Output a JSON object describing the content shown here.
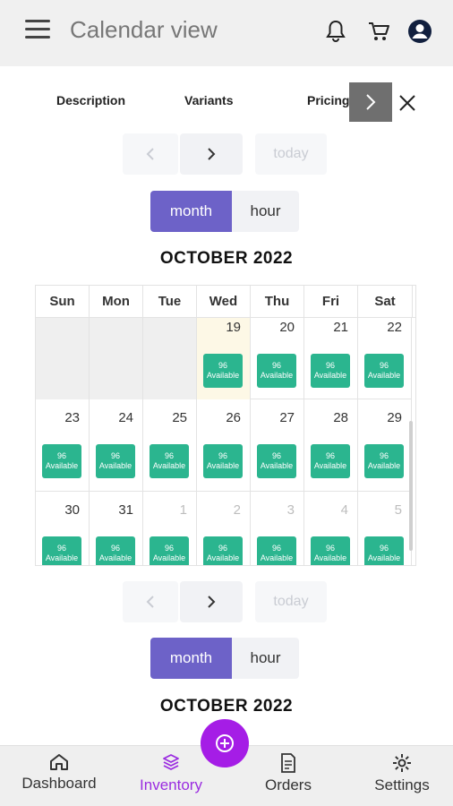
{
  "appbar": {
    "title": "Calendar view"
  },
  "tabs": [
    {
      "label": "Description"
    },
    {
      "label": "Variants"
    },
    {
      "label": "Pricing"
    }
  ],
  "nav": {
    "today_label": "today"
  },
  "view_toggle": {
    "month": "month",
    "hour": "hour"
  },
  "calendar": {
    "title": "OCTOBER 2022",
    "weekdays": [
      "Sun",
      "Mon",
      "Tue",
      "Wed",
      "Thu",
      "Fri",
      "Sat"
    ],
    "weeks": [
      [
        "",
        "",
        "",
        "19",
        "20",
        "21",
        "22"
      ],
      [
        "23",
        "24",
        "25",
        "26",
        "27",
        "28",
        "29"
      ],
      [
        "30",
        "31",
        "1",
        "2",
        "3",
        "4",
        "5"
      ]
    ],
    "chip_count": "96",
    "chip_text": "Available"
  },
  "calendar2": {
    "title": "OCTOBER 2022"
  },
  "bottom_nav": [
    {
      "label": "Dashboard"
    },
    {
      "label": "Inventory"
    },
    {
      "label": "Orders"
    },
    {
      "label": "Settings"
    }
  ],
  "colors": {
    "accent": "#6d62c8",
    "chip": "#2bb58f",
    "fab": "#a51de6",
    "active_nav": "#9a2be0"
  }
}
